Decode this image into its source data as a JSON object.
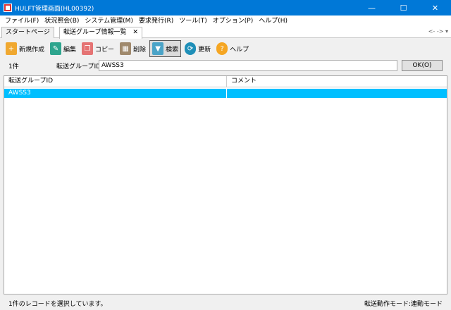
{
  "window": {
    "title": "HULFT管理画面(HL00392)"
  },
  "menu": [
    "ファイル(F)",
    "状況照会(B)",
    "システム管理(M)",
    "要求発行(R)",
    "ツール(T)",
    "オプション(P)",
    "ヘルプ(H)"
  ],
  "tabs": [
    {
      "label": "スタートページ"
    },
    {
      "label": "転送グループ情報一覧"
    }
  ],
  "tab_nav": "<- -> ▾",
  "toolbar": {
    "new": "新規作成",
    "edit": "編集",
    "copy": "コピー",
    "delete": "削除",
    "search": "検索",
    "refresh": "更新",
    "help": "ヘルプ"
  },
  "filter": {
    "count": "1件",
    "label": "転送グループID",
    "value": "AWSS3",
    "ok": "OK(O)"
  },
  "table": {
    "columns": [
      "転送グループID",
      "コメント"
    ],
    "rows": [
      {
        "id": "AWSS3",
        "comment": ""
      }
    ]
  },
  "status": {
    "left": "1件のレコードを選択しています。",
    "right": "転送動作モード:連動モード"
  },
  "colors": {
    "titlebar": "#0078d7",
    "selection": "#00bfff"
  }
}
